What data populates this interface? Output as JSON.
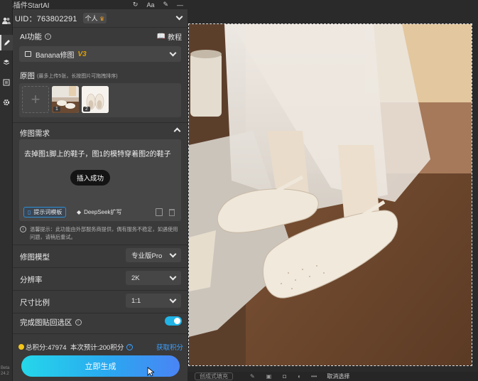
{
  "plugin": {
    "title": "s插件StartAI",
    "title_icons": [
      "refresh-icon",
      "font-size-icon",
      "pin-icon",
      "minimize-icon"
    ]
  },
  "user": {
    "uid_label": "UID：763802291",
    "account_type": "个人",
    "account_icon": "crown-icon"
  },
  "ai_function": {
    "label": "AI功能",
    "tutorial_label": "教程",
    "selected_tool": "Banana修图",
    "tool_version": "V3"
  },
  "source_images": {
    "label": "原图",
    "hint": "(最多上传5张，长按图片可拖拽排序)",
    "thumbnails": [
      {
        "number": "1",
        "alt": "photo of feet in ballet flats"
      },
      {
        "number": "2",
        "alt": "cream ballet flats"
      }
    ]
  },
  "edit_request": {
    "label": "修图需求",
    "prompt_text": "去掉图1脚上的鞋子，图1的模特穿着图2的鞋子",
    "toast": "插入成功",
    "template_button": "提示词模板",
    "deepseek_button": "DeepSeek扩写",
    "notice": "温馨提示：此功能由外部服务商提供，偶有服务不稳定，如遇使用问题，请稍后重试。"
  },
  "settings": [
    {
      "label": "修图模型",
      "value": "专业版Pro"
    },
    {
      "label": "分辨率",
      "value": "2K"
    },
    {
      "label": "尺寸比例",
      "value": "1:1"
    }
  ],
  "paste_back": {
    "label": "完成图贴回选区",
    "enabled": true
  },
  "points": {
    "summary": "总积分:47974  本次预计:200积分",
    "get_points_link": "获取积分"
  },
  "generate_button": "立即生成",
  "app_version": "Beta 24.2",
  "canvas_bottombar": {
    "left_label": "创成式填充",
    "right_label": "取消选择"
  },
  "colors": {
    "accent": "#21b4e6",
    "link": "#3aa0ff",
    "points_dot": "#f5c518",
    "version_gold": "#e0a100"
  }
}
